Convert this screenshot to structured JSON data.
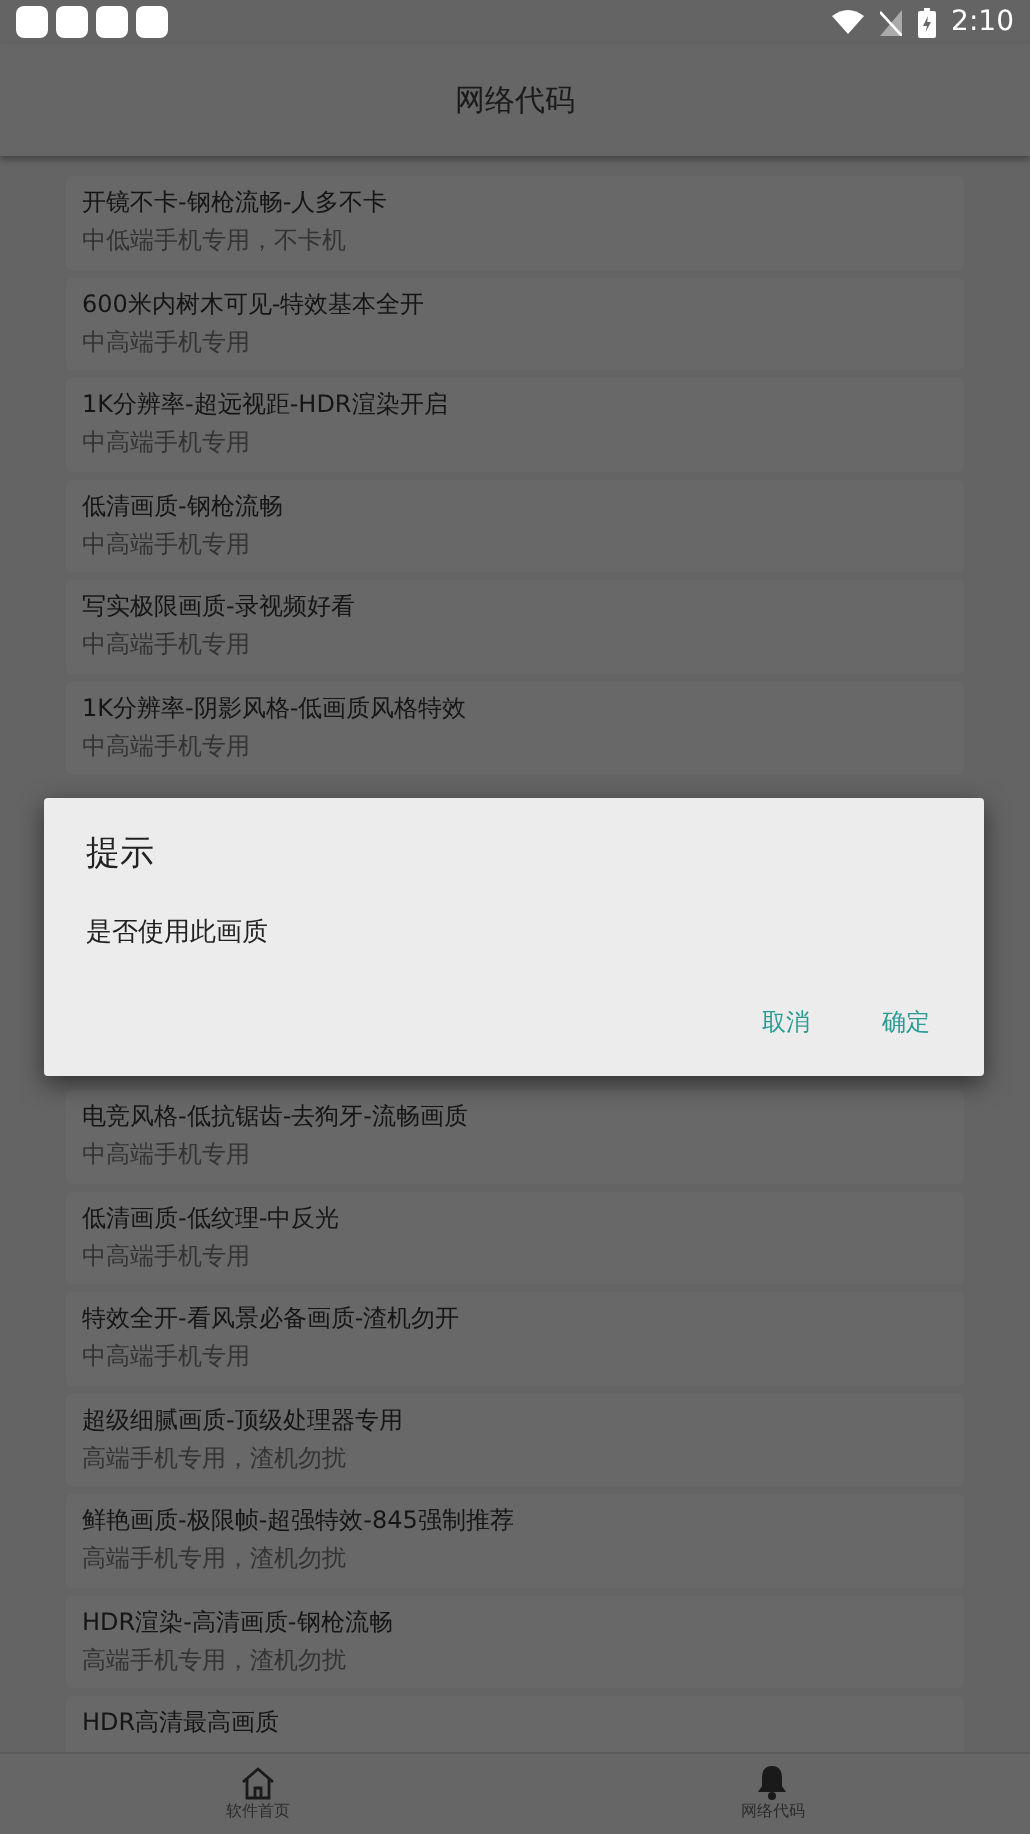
{
  "status_bar": {
    "time": "2:10"
  },
  "header": {
    "title": "网络代码"
  },
  "list_top": [
    {
      "title": "开镜不卡-钢枪流畅-人多不卡",
      "subtitle": "中低端手机专用，不卡机"
    },
    {
      "title": "600米内树木可见-特效基本全开",
      "subtitle": "中高端手机专用"
    },
    {
      "title": "1K分辨率-超远视距-HDR渲染开启",
      "subtitle": "中高端手机专用"
    },
    {
      "title": "低清画质-钢枪流畅",
      "subtitle": "中高端手机专用"
    },
    {
      "title": "写实极限画质-录视频好看",
      "subtitle": "中高端手机专用"
    },
    {
      "title": "1K分辨率-阴影风格-低画质风格特效",
      "subtitle": "中高端手机专用"
    }
  ],
  "list_bottom": [
    {
      "title": "电竞风格-低抗锯齿-去狗牙-流畅画质",
      "subtitle": "中高端手机专用"
    },
    {
      "title": "低清画质-低纹理-中反光",
      "subtitle": "中高端手机专用"
    },
    {
      "title": "特效全开-看风景必备画质-渣机勿开",
      "subtitle": "中高端手机专用"
    },
    {
      "title": "超级细腻画质-顶级处理器专用",
      "subtitle": "高端手机专用，渣机勿扰"
    },
    {
      "title": "鲜艳画质-极限帧-超强特效-845强制推荐",
      "subtitle": "高端手机专用，渣机勿扰"
    },
    {
      "title": "HDR渲染-高清画质-钢枪流畅",
      "subtitle": "高端手机专用，渣机勿扰"
    },
    {
      "title": "HDR高清最高画质"
    }
  ],
  "dialog": {
    "title": "提示",
    "message": "是否使用此画质",
    "buttons": [
      "取消",
      "确定"
    ]
  },
  "bottom_nav": [
    {
      "kind": "home",
      "label": "软件首页"
    },
    {
      "kind": "bell",
      "label": "网络代码"
    }
  ]
}
